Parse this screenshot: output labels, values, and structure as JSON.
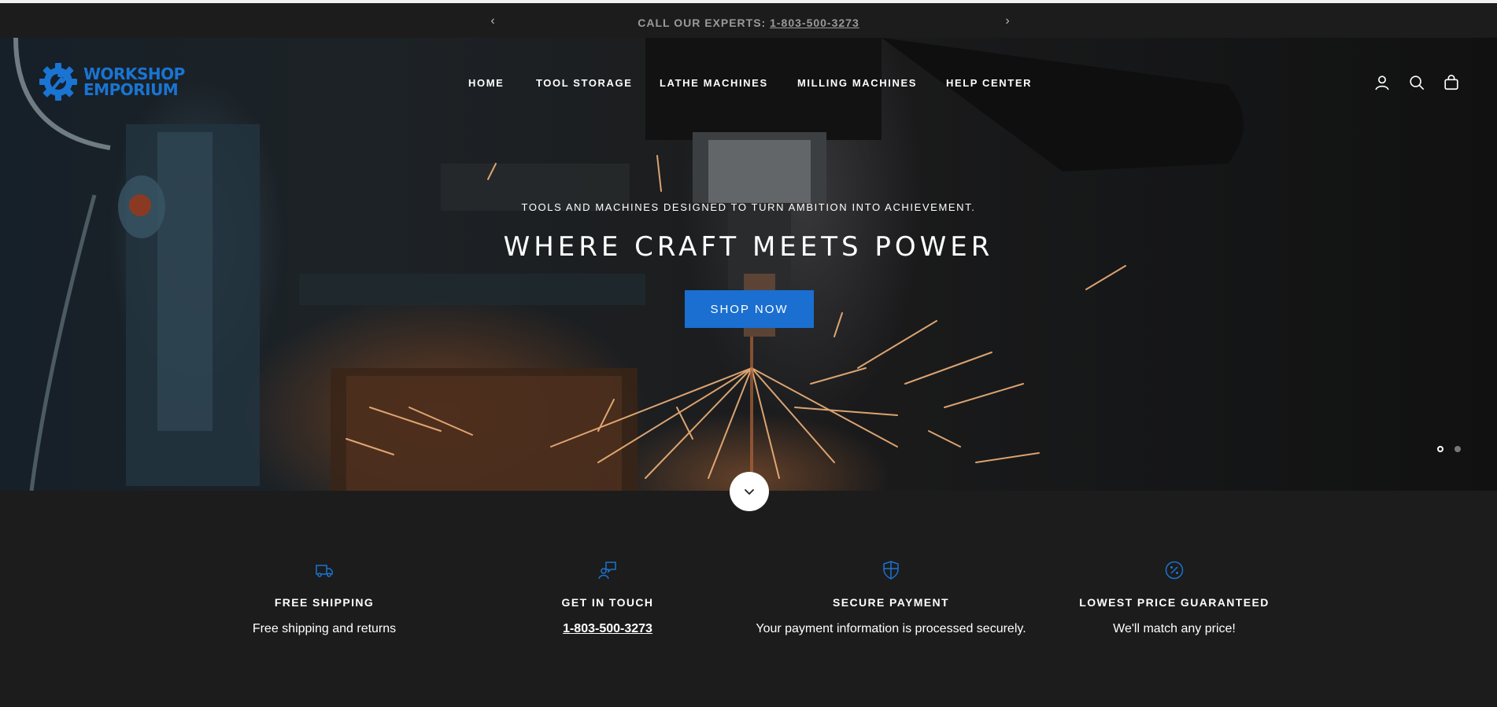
{
  "announcement": {
    "label": "CALL OUR EXPERTS: ",
    "phone": "1-803-500-3273",
    "prev_icon": "chevron-left-icon",
    "next_icon": "chevron-right-icon"
  },
  "brand": {
    "line1": "WORKSHOP",
    "line2": "EMPORIUM",
    "color": "#1a74d2"
  },
  "nav": {
    "items": [
      {
        "label": "HOME"
      },
      {
        "label": "TOOL STORAGE"
      },
      {
        "label": "LATHE MACHINES"
      },
      {
        "label": "MILLING MACHINES"
      },
      {
        "label": "HELP CENTER"
      }
    ]
  },
  "header_icons": [
    "account-icon",
    "search-icon",
    "cart-icon"
  ],
  "hero": {
    "subtitle": "TOOLS AND MACHINES DESIGNED TO TURN AMBITION INTO ACHIEVEMENT.",
    "title": "WHERE CRAFT MEETS POWER",
    "cta": "SHOP NOW",
    "accent": "#1a6fd0",
    "slides_total": 2,
    "active_slide": 1
  },
  "features": [
    {
      "icon": "truck-icon",
      "title": "FREE SHIPPING",
      "text": "Free shipping and returns"
    },
    {
      "icon": "chat-support-icon",
      "title": "GET IN TOUCH",
      "text": "1-803-500-3273"
    },
    {
      "icon": "shield-icon",
      "title": "SECURE PAYMENT",
      "text": "Your payment information is processed securely."
    },
    {
      "icon": "percent-badge-icon",
      "title": "LOWEST PRICE GUARANTEED",
      "text": "We'll match any price!"
    }
  ]
}
